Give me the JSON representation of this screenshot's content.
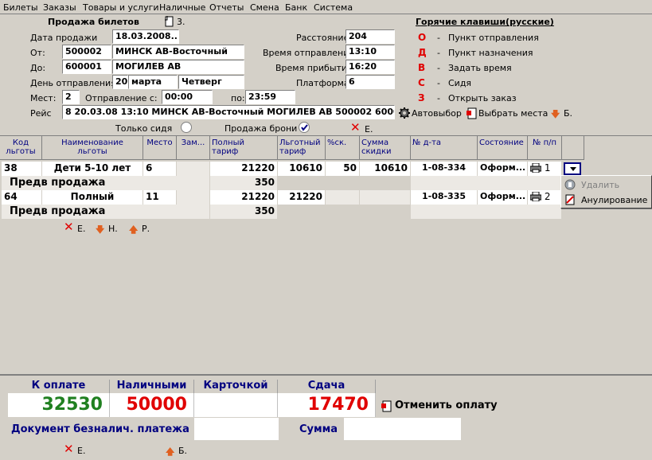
{
  "menu": [
    "Билеты",
    "Заказы",
    "Товары и услуги",
    "Наличные",
    "Отчеты",
    "Смена",
    "Банк",
    "Система"
  ],
  "form": {
    "title": "Продажа билетов",
    "title_num": "3.",
    "sale_date_label": "Дата продажи",
    "sale_date": "18.03.2008...",
    "from_label": "От:",
    "from_code": "500002",
    "from_name": "МИНСК АВ-Восточный",
    "to_label": "До:",
    "to_code": "600001",
    "to_name": "МОГИЛЕВ АВ",
    "dep_day_label": "День отправления",
    "dep_day": "20",
    "dep_month": "марта",
    "dep_weekday": "Четверг",
    "seats_label": "Мест:",
    "seats": "2",
    "dep_from_label": "Отправление с:",
    "dep_from": "00:00",
    "dep_to_label": "по:",
    "dep_to": "23:59",
    "trip_label": "Рейс",
    "trip": "8 20.03.08 13:10 МИНСК АВ-Восточный МОГИЛЕВ АВ 500002 600001",
    "distance_label": "Расстояние",
    "distance": "204",
    "dep_time_label": "Время отправления",
    "dep_time": "13:10",
    "arr_time_label": "Время прибытия",
    "arr_time": "16:20",
    "platform_label": "Платформа",
    "platform": "6",
    "autoselect": "Автовыбор",
    "choose_seats": "Выбрать места",
    "b_label": "Б.",
    "only_sitting": "Только сидя",
    "booking_sale": "Продажа брони",
    "e_label": "Е."
  },
  "hotkeys": {
    "title": "Горячие клавиши(русские)",
    "items": [
      {
        "key": "О",
        "text": "Пункт отправления"
      },
      {
        "key": "Д",
        "text": "Пункт назначения"
      },
      {
        "key": "В",
        "text": "Задать время"
      },
      {
        "key": "С",
        "text": "Сидя"
      },
      {
        "key": "З",
        "text": "Открыть заказ"
      }
    ]
  },
  "table": {
    "headers": [
      {
        "l1": "Код",
        "l2": "льготы"
      },
      {
        "l1": "Наименование",
        "l2": "льготы"
      },
      {
        "l1": "Место",
        "l2": ""
      },
      {
        "l1": "Зам...",
        "l2": ""
      },
      {
        "l1": "Полный",
        "l2": "тариф"
      },
      {
        "l1": "Льготный",
        "l2": "тариф"
      },
      {
        "l1": "%ск.",
        "l2": ""
      },
      {
        "l1": "Сумма",
        "l2": "скидки"
      },
      {
        "l1": "№ д-та",
        "l2": ""
      },
      {
        "l1": "Состояние",
        "l2": ""
      },
      {
        "l1": "№ п/п",
        "l2": ""
      }
    ],
    "rows": [
      {
        "code": "38",
        "name": "Дети 5-10 лет",
        "seat": "6",
        "full": "21220",
        "discount_tariff": "10610",
        "pct": "50",
        "discount_sum": "10610",
        "doc": "1-08-334",
        "state": "Оформ...",
        "num": "1"
      },
      {
        "code": "64",
        "name": "Полный",
        "seat": "11",
        "full": "21220",
        "discount_tariff": "21220",
        "pct": "",
        "discount_sum": "",
        "doc": "1-08-335",
        "state": "Оформ...",
        "num": "2"
      }
    ],
    "presale_label": "Предв продажа",
    "presale_value": "350",
    "footer": {
      "e": "Е.",
      "n": "Н.",
      "r": "Р."
    }
  },
  "context_menu": {
    "items": [
      {
        "label": "Удалить",
        "enabled": false
      },
      {
        "label": "Анулирование",
        "enabled": true
      }
    ]
  },
  "payment": {
    "to_pay_label": "К оплате",
    "to_pay": "32530",
    "cash_label": "Наличными",
    "cash": "50000",
    "card_label": "Карточкой",
    "card": "",
    "change_label": "Сдача",
    "change": "17470",
    "cancel_payment": "Отменить оплату",
    "cashless_doc_label": "Документ безналич. платежа",
    "sum_label": "Сумма",
    "e": "Е.",
    "b": "Б."
  },
  "colors": {
    "green": "#208020",
    "red": "#e00000",
    "navy": "#000080"
  }
}
